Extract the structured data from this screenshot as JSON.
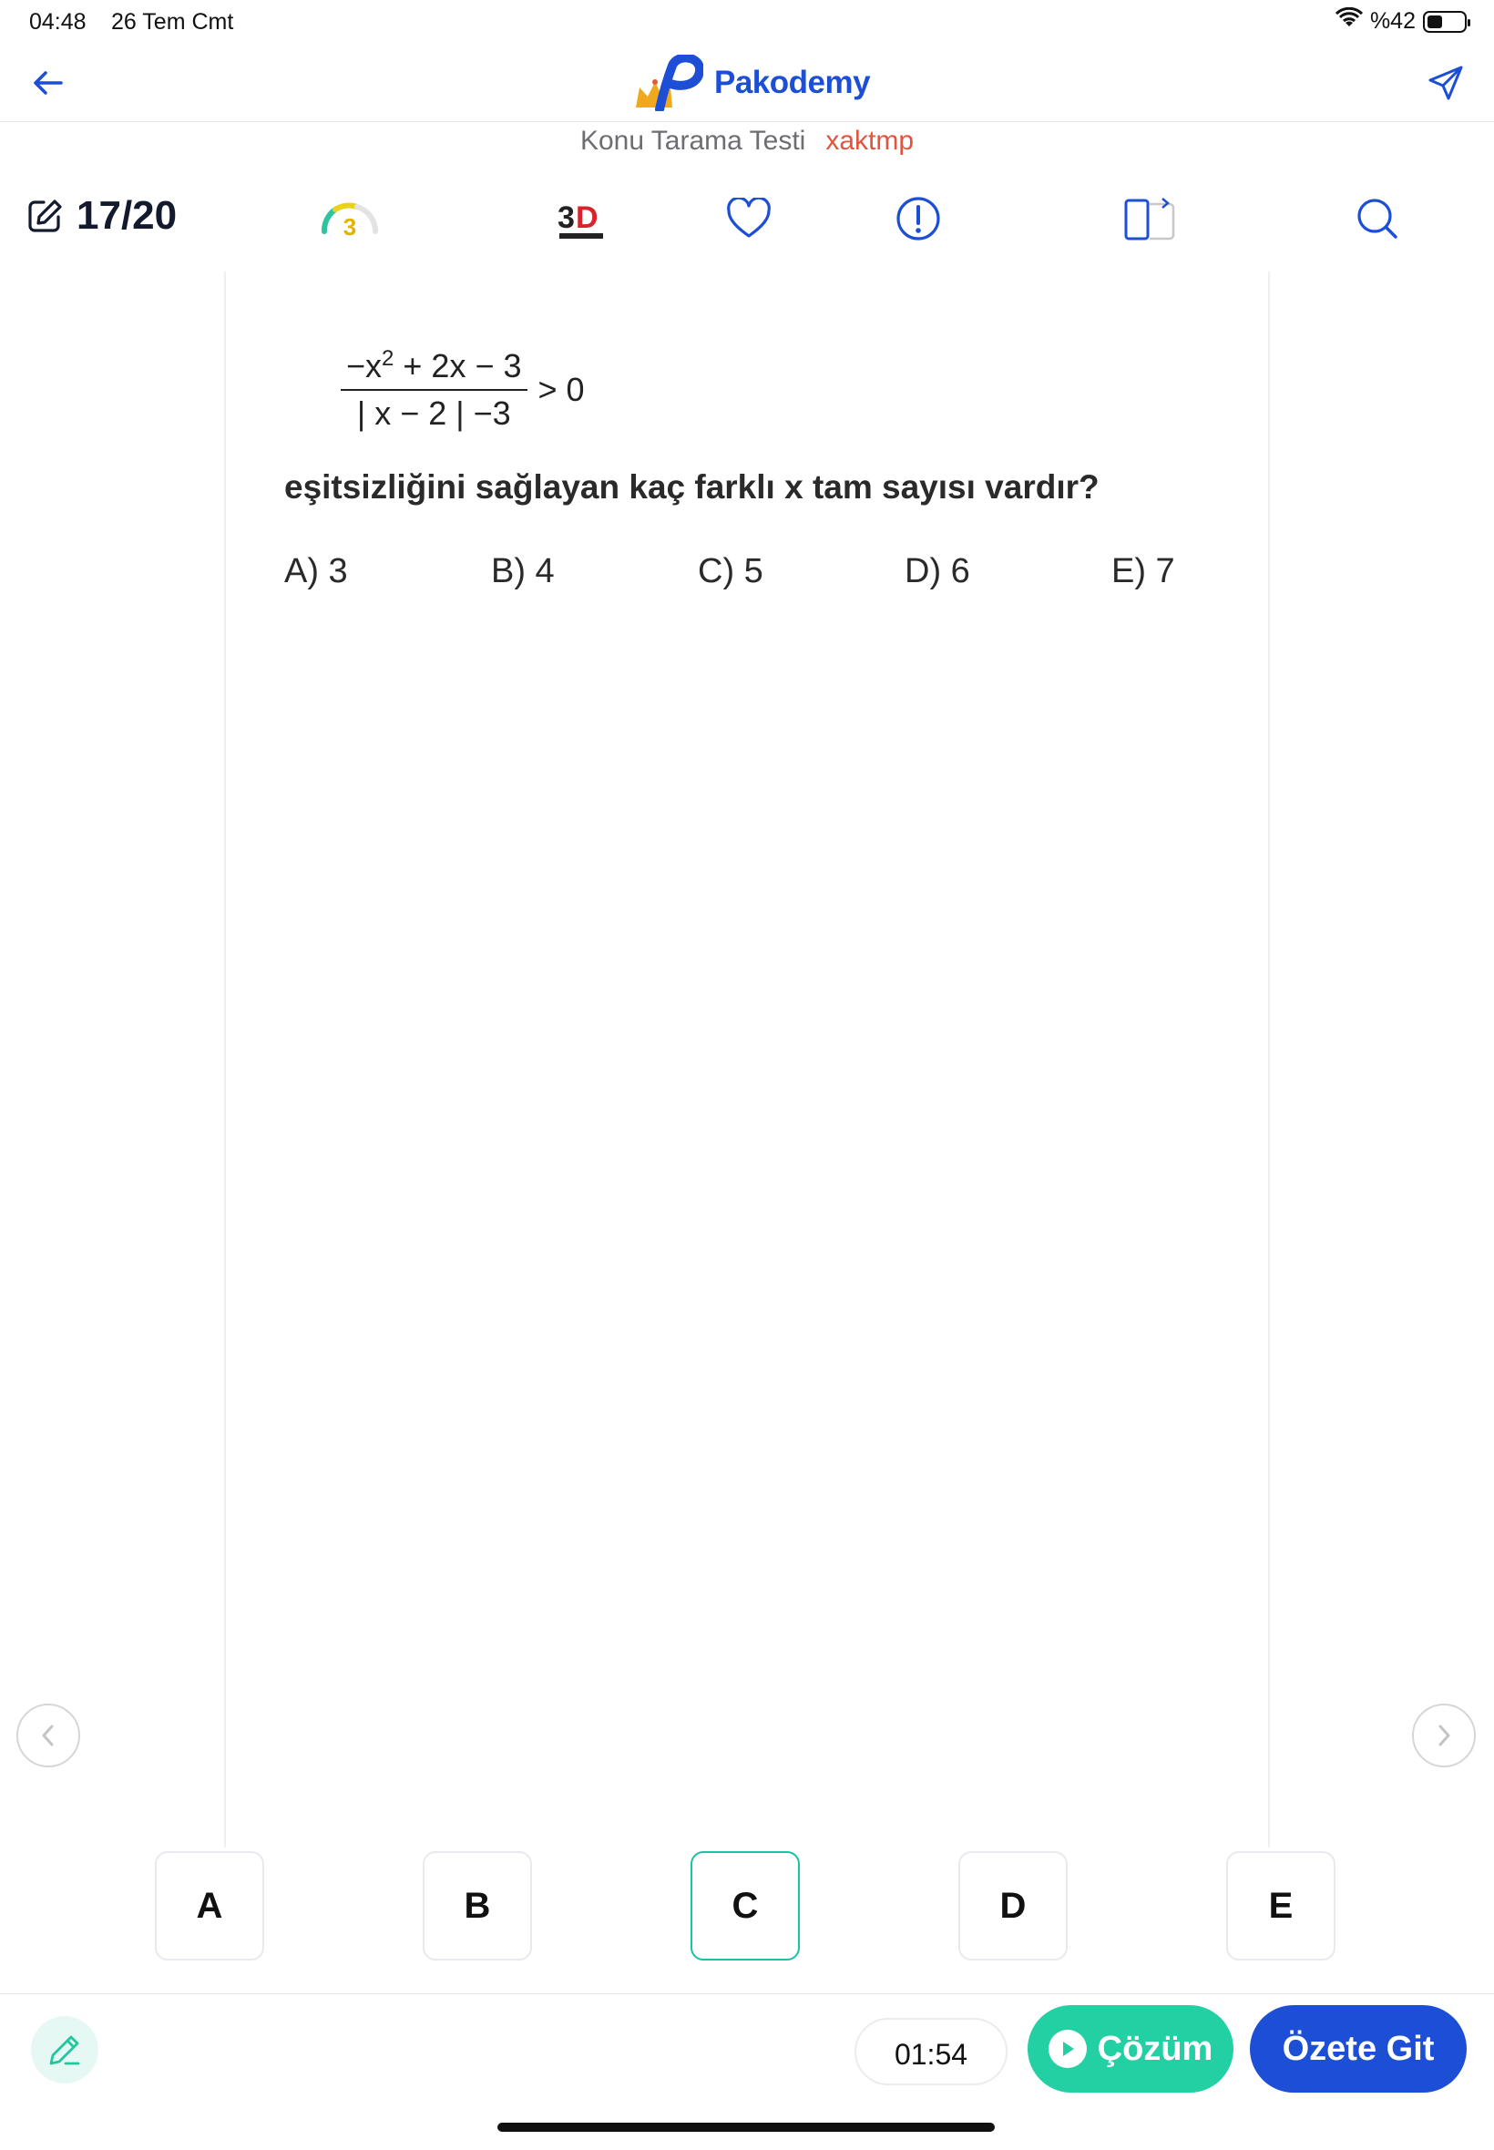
{
  "status_bar": {
    "time": "04:48",
    "date": "26 Tem Cmt",
    "battery": "%42",
    "battery_level": 0.42
  },
  "header": {
    "app_name": "Pakodemy"
  },
  "subtitle": {
    "test_name": "Konu Tarama Testi",
    "code": "xaktmp"
  },
  "toolbar": {
    "question_counter": "17/20",
    "level": "3",
    "publisher_icon": "3d-yayinlari-logo"
  },
  "question": {
    "numerator": {
      "minus": "−x",
      "exp": "2",
      "rest": " + 2x − 3"
    },
    "denominator": "| x − 2 | −3",
    "relation": "> 0",
    "text": "eşitsizliğini sağlayan kaç farklı x tam sayısı vardır?",
    "options": [
      "A) 3",
      "B) 4",
      "C) 5",
      "D) 6",
      "E) 7"
    ]
  },
  "answers": {
    "labels": [
      "A",
      "B",
      "C",
      "D",
      "E"
    ],
    "selected": "C"
  },
  "bottom": {
    "timer": "01:54",
    "solution_label": "Çözüm",
    "summary_label": "Özete Git"
  },
  "colors": {
    "brand_blue": "#1c4fd6",
    "accent_green": "#22d0a4",
    "code_red": "#e0553f"
  }
}
